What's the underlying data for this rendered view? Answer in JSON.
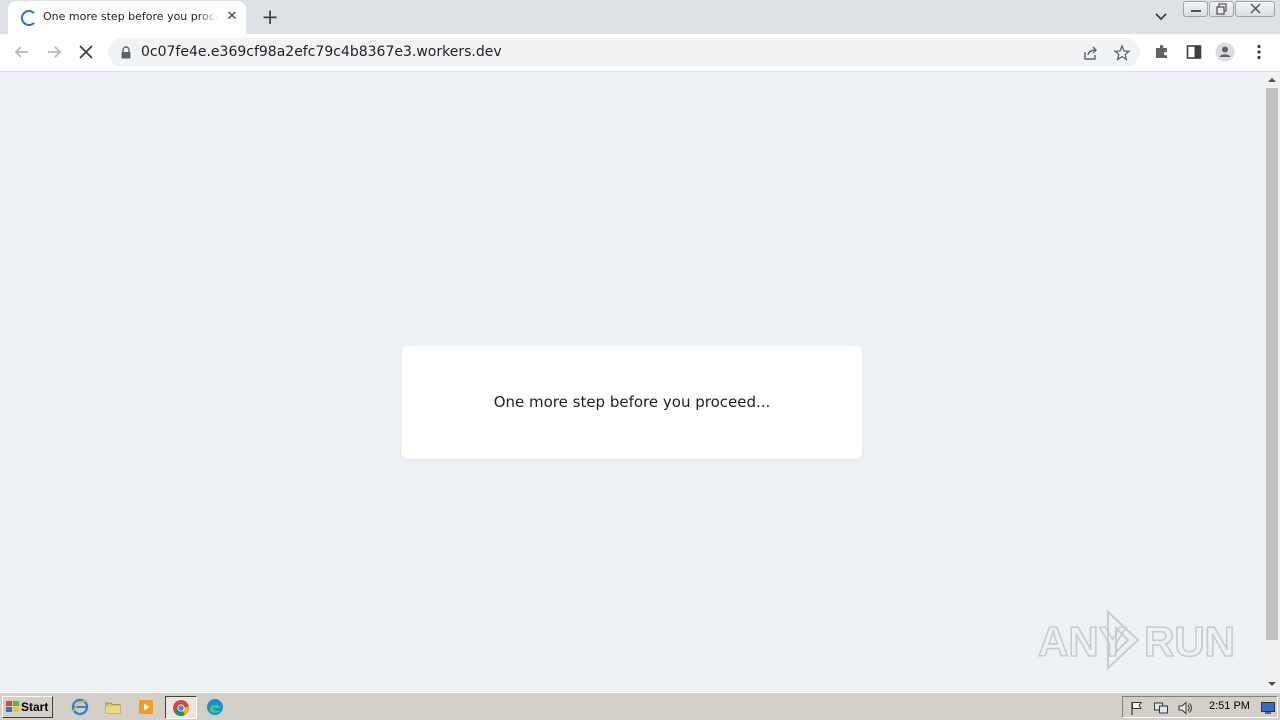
{
  "browser": {
    "tab": {
      "title": "One more step before you proceed...",
      "loading_icon": "spinner-icon",
      "close_icon": "close-icon"
    },
    "new_tab_icon": "plus-icon",
    "tab_search_icon": "chevron-down-icon",
    "window_controls": [
      "minimize-icon",
      "restore-icon",
      "close-icon"
    ],
    "toolbar": {
      "back_icon": "arrow-left-icon",
      "forward_icon": "arrow-right-icon",
      "stop_icon": "stop-icon",
      "lock_icon": "lock-icon",
      "url": "0c07fe4e.e369cf98a2efc79c4b8367e3.workers.dev",
      "share_icon": "share-icon",
      "bookmark_icon": "star-icon",
      "extensions_icon": "puzzle-icon",
      "side_panel_icon": "side-panel-icon",
      "profile_icon": "person-icon",
      "menu_icon": "kebab-menu-icon"
    }
  },
  "page": {
    "card_text": "One more step before you proceed..."
  },
  "watermark": {
    "text": "ANY RUN"
  },
  "taskbar": {
    "start_label": "Start",
    "quick_launch": [
      "internet-explorer-icon",
      "folder-icon",
      "media-player-icon",
      "chrome-icon",
      "edge-icon"
    ],
    "tray_icons": [
      "flag-icon",
      "network-icon",
      "volume-icon",
      "desktop-icon"
    ],
    "clock": "2:51 PM"
  },
  "colors": {
    "accent": "#1a73e8",
    "page_background": "#eef2f6",
    "card_background": "#ffffff",
    "taskbar": "#d4d0c8"
  }
}
